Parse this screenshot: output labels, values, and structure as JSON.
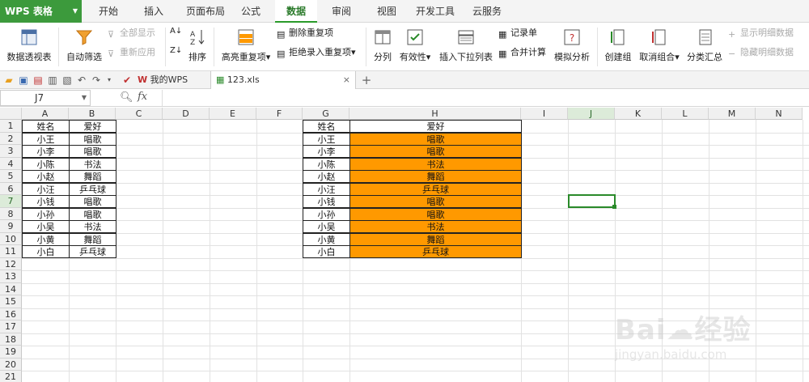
{
  "app": {
    "title": "WPS 表格",
    "accent": "#3c9a3c"
  },
  "menu": {
    "tabs": [
      "开始",
      "插入",
      "页面布局",
      "公式",
      "数据",
      "审阅",
      "视图",
      "开发工具",
      "云服务"
    ],
    "active": "数据"
  },
  "toolbar": {
    "pivot": "数据透视表",
    "autofilter": "自动筛选",
    "show_all": "全部显示",
    "reapply": "重新应用",
    "sort": "排序",
    "highlight_dup": "高亮重复项",
    "delete_dup": "删除重复项",
    "reject_dup": "拒绝录入重复项",
    "split": "分列",
    "validity": "有效性",
    "dropdown": "插入下拉列表",
    "record": "记录单",
    "consolidate": "合并计算",
    "simulate": "模拟分析",
    "group": "创建组",
    "ungroup": "取消组合",
    "subtotal": "分类汇总",
    "show_detail": "显示明细数据",
    "hide_detail": "隐藏明细数据"
  },
  "tabs": {
    "my_wps": "我的WPS",
    "file": "123.xls"
  },
  "formula": {
    "cell_ref": "J7",
    "fx": "fx",
    "value": ""
  },
  "columns": [
    "A",
    "B",
    "C",
    "D",
    "E",
    "F",
    "G",
    "H",
    "I",
    "J",
    "K",
    "L",
    "M",
    "N"
  ],
  "selected_col": "J",
  "rows": [
    "1",
    "2",
    "3",
    "4",
    "5",
    "6",
    "7",
    "8",
    "9",
    "10",
    "11",
    "12",
    "13",
    "14",
    "15",
    "16",
    "17",
    "18",
    "19",
    "20",
    "21"
  ],
  "selected_row": "7",
  "left_table": {
    "headers": [
      "姓名",
      "爱好"
    ],
    "names": [
      "小王",
      "小李",
      "小陈",
      "小赵",
      "小汪",
      "小钱",
      "小孙",
      "小吴",
      "小黄",
      "小白"
    ],
    "hobbies": [
      "唱歌",
      "唱歌",
      "书法",
      "舞蹈",
      "乒乓球",
      "唱歌",
      "唱歌",
      "书法",
      "舞蹈",
      "乒乓球"
    ]
  },
  "right_table": {
    "headers": [
      "姓名",
      "爱好"
    ],
    "names": [
      "小王",
      "小李",
      "小陈",
      "小赵",
      "小汪",
      "小钱",
      "小孙",
      "小吴",
      "小黄",
      "小白"
    ],
    "hobbies": [
      "唱歌",
      "唱歌",
      "书法",
      "舞蹈",
      "乒乓球",
      "唱歌",
      "唱歌",
      "书法",
      "舞蹈",
      "乒乓球"
    ],
    "highlight_color": "#ff9900"
  },
  "watermark": "jingyan.baidu.com"
}
